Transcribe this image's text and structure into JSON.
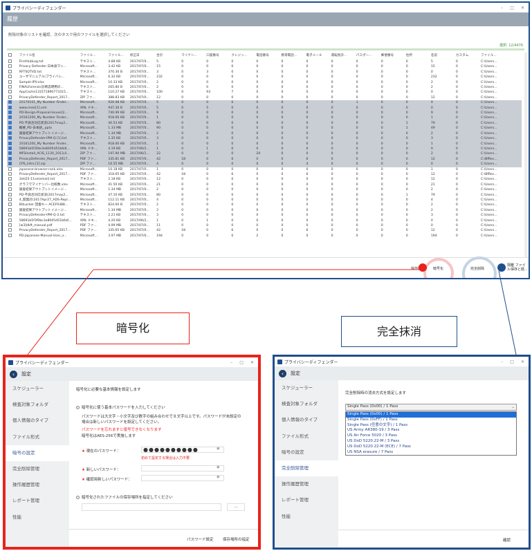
{
  "main": {
    "window_title": "プライバシーディフェンダー",
    "header": "履歴",
    "description": "削除対象のリストを確認、次のタスク用のファイルを選択してください",
    "selected_count": "選択: 12/4476",
    "columns": [
      "ファイル名",
      "ファイル...",
      "ファイル...",
      "修正日",
      "合計",
      "マイナン...",
      "口座番号",
      "クレジッ...",
      "電話番号",
      "携帯電話...",
      "電子メール",
      "運転免許...",
      "パスポー...",
      "郵便番号",
      "住所",
      "名前",
      "カスタム",
      "ファイル..."
    ],
    "rows": [
      {
        "on": false,
        "c": [
          "FirstHubLog.txt",
          "テキスト...",
          "4.88 KB",
          "2017/07/0...",
          "5",
          "0",
          "0",
          "0",
          "0",
          "0",
          "0",
          "0",
          "0",
          "0",
          "0",
          "5",
          "0",
          "C:\\Users..."
        ]
      },
      {
        "on": false,
        "c": [
          "Privacy Defender 日本語マニ...",
          "Microsoft...",
          "3.42 KB",
          "2017/07/0...",
          "15",
          "0",
          "0",
          "0",
          "0",
          "0",
          "0",
          "0",
          "0",
          "0",
          "0",
          "15",
          "0",
          "C:\\Users..."
        ]
      },
      {
        "on": false,
        "c": [
          "RFTSQTVD.txt",
          "テキスト...",
          "370.30 B",
          "2017/07/0...",
          "3",
          "0",
          "3",
          "0",
          "0",
          "0",
          "0",
          "0",
          "0",
          "0",
          "0",
          "0",
          "0",
          "C:\\Users..."
        ]
      },
      {
        "on": false,
        "c": [
          "ユーザマニュアル(プライバシ...",
          "Microsoft...",
          "6.32 KB",
          "2017/07/0...",
          "232",
          "0",
          "0",
          "0",
          "0",
          "0",
          "0",
          "0",
          "0",
          "0",
          "0",
          "232",
          "0",
          "C:\\Users..."
        ]
      },
      {
        "on": false,
        "c": [
          "Sample-IPV.xlsx",
          "Microsoft...",
          "10.33 KB",
          "2017/07/0...",
          "2",
          "0",
          "0",
          "0",
          "0",
          "0",
          "0",
          "0",
          "0",
          "0",
          "0",
          "2",
          "0",
          "C:\\Users..."
        ]
      },
      {
        "on": false,
        "c": [
          "FINALForensic診断説明用の...",
          "テキスト...",
          "265.80 B",
          "2017/07/0...",
          "2",
          "0",
          "0",
          "0",
          "0",
          "0",
          "0",
          "0",
          "0",
          "0",
          "0",
          "2",
          "0",
          "C:\\Users..."
        ]
      },
      {
        "on": false,
        "c": [
          "AppCache131571890773315...",
          "テキスト...",
          "110.27 KB",
          "2017/07/0...",
          "100",
          "0",
          "93",
          "7",
          "0",
          "0",
          "0",
          "0",
          "0",
          "0",
          "0",
          "0",
          "0",
          "C:\\Users..."
        ]
      },
      {
        "on": false,
        "c": [
          "PrivacyDefender_Report_2017...",
          "ZIP ファ...",
          "388.83 KB",
          "2017/07/0...",
          "12",
          "0",
          "0",
          "0",
          "0",
          "0",
          "0",
          "0",
          "0",
          "0",
          "0",
          "12",
          "0",
          "C:\\Users..."
        ]
      },
      {
        "on": true,
        "c": [
          "20170101_My Number Finder...",
          "Microsoft...",
          "926.08 KB",
          "2017/07/0...",
          "5",
          "0",
          "0",
          "0",
          "0",
          "0",
          "0",
          "0",
          "1",
          "0",
          "0",
          "0",
          "0",
          "C:\\Users..."
        ]
      },
      {
        "on": true,
        "c": [
          "www.msie[1].xml",
          "XML ドキ...",
          "947.30 B",
          "2017/07/0...",
          "5",
          "0",
          "5",
          "0",
          "0",
          "0",
          "0",
          "0",
          "0",
          "0",
          "0",
          "0",
          "0",
          "C:\\Users..."
        ]
      },
      {
        "on": true,
        "c": [
          "PD-Design-Proposal-Issues[2...",
          "Microsoft...",
          "740.99 KB",
          "2017/07/0...",
          "9",
          "0",
          "0",
          "0",
          "0",
          "0",
          "0",
          "0",
          "0",
          "0",
          "0",
          "9",
          "0",
          "C:\\Users..."
        ]
      },
      {
        "on": true,
        "c": [
          "20161200_My Number Finder...",
          "Microsoft...",
          "918.00 KB",
          "2017/07/0...",
          "1",
          "0",
          "0",
          "0",
          "0",
          "0",
          "0",
          "0",
          "0",
          "0",
          "0",
          "1",
          "0",
          "C:\\Users..."
        ]
      },
      {
        "on": true,
        "c": [
          "PD-不具合対応状況(2017may2...",
          "Microsoft...",
          "40.53 KB",
          "2017/07/0...",
          "80",
          "0",
          "0",
          "0",
          "0",
          "0",
          "0",
          "0",
          "0",
          "0",
          "1",
          "79",
          "0",
          "C:\\Users..."
        ]
      },
      {
        "on": true,
        "c": [
          "概要_PD-日本語_.pptx",
          "Microsoft...",
          "1.33 MB",
          "2017/07/0...",
          "90",
          "0",
          "0",
          "0",
          "0",
          "0",
          "0",
          "0",
          "0",
          "0",
          "1",
          "49",
          "0",
          "C:\\Users..."
        ]
      },
      {
        "on": true,
        "c": [
          "調査結果アウトプットイメージ...",
          "Microsoft...",
          "1.34 MB",
          "2017/07/0...",
          "2",
          "0",
          "0",
          "0",
          "0",
          "0",
          "0",
          "0",
          "0",
          "0",
          "0",
          "2",
          "0",
          "C:\\Users..."
        ]
      },
      {
        "on": true,
        "c": [
          "PrivacyDefender-IPM-Q [1].txt",
          "テキスト...",
          "2.35 KB",
          "2017/07/0...",
          "3",
          "0",
          "0",
          "0",
          "0",
          "0",
          "0",
          "0",
          "0",
          "0",
          "0",
          "3",
          "0",
          "C:\\Users..."
        ]
      },
      {
        "on": true,
        "c": [
          "20161200_My Number Finder...",
          "Microsoft...",
          "918.00 KB",
          "2017/07/0...",
          "1",
          "0",
          "0",
          "0",
          "0",
          "0",
          "0",
          "0",
          "0",
          "0",
          "0",
          "1",
          "0",
          "C:\\Users..."
        ]
      },
      {
        "on": true,
        "c": [
          "58691b5f3fde3e8005d51b6d[...",
          "XML ドキ...",
          "4.19 KB",
          "2017/06/2...",
          "1",
          "0",
          "1",
          "0",
          "0",
          "0",
          "0",
          "0",
          "0",
          "0",
          "0",
          "0",
          "0",
          "C:\\Users..."
        ]
      },
      {
        "on": true,
        "c": [
          "MFSInstall_ACIS_1130_2013,0...",
          "ZIP ファ...",
          "197.90 MB",
          "2017/06/1...",
          "22",
          "0",
          "0",
          "0",
          "20",
          "0",
          "0",
          "0",
          "0",
          "0",
          "0",
          "2",
          "0",
          "C:\\Users..."
        ]
      },
      {
        "on": true,
        "c": [
          "PrivacyDefender_Report_2017...",
          "PDF ファ...",
          "335.81 KB",
          "2017/07/0...",
          "42",
          "18",
          "0",
          "6",
          "0",
          "0",
          "6",
          "0",
          "0",
          "0",
          "0",
          "12",
          "0",
          "C:\\BfRec..."
        ]
      },
      {
        "on": true,
        "c": [
          "CPS_Intro [1].zip",
          "ZIP ファ...",
          "16.55 MB",
          "2017/07/0...",
          "4",
          "0",
          "0",
          "0",
          "0",
          "0",
          "4",
          "0",
          "0",
          "0",
          "0",
          "0",
          "0",
          "C:\\Users..."
        ]
      },
      {
        "on": false,
        "c": [
          "japanese-browser-rank.xlsx",
          "Microsoft...",
          "10.18 KB",
          "2017/07/0...",
          "1",
          "0",
          "0",
          "0",
          "0",
          "0",
          "0",
          "0",
          "0",
          "0",
          "0",
          "1",
          "0",
          "C:\\Users..."
        ]
      },
      {
        "on": false,
        "c": [
          "PrivacyDefender_Report_2017...",
          "PDF ファ...",
          "318.65 KB",
          "2017/07/0...",
          "42",
          "18",
          "0",
          "6",
          "0",
          "0",
          "6",
          "0",
          "0",
          "0",
          "0",
          "12",
          "0",
          "C:\\BfRec..."
        ]
      },
      {
        "on": false,
        "c": [
          "3eti25-11ce(email).txt",
          "テキスト...",
          "2.18 KB",
          "2017/07/0...",
          "12",
          "0",
          "0",
          "0",
          "0",
          "0",
          "0",
          "0",
          "0",
          "0",
          "0",
          "12",
          "0",
          "C:\\Users..."
        ]
      },
      {
        "on": false,
        "c": [
          "グラフでマイナンバー比較数.xlsx",
          "Microsoft...",
          "41.50 KB",
          "2017/07/0...",
          "21",
          "0",
          "0",
          "0",
          "0",
          "0",
          "0",
          "0",
          "0",
          "0",
          "0",
          "21",
          "0",
          "C:\\Users..."
        ]
      },
      {
        "on": false,
        "c": [
          "調査結果アウトプットイメージ...",
          "Microsoft...",
          "1.34 MB",
          "2017/07/0...",
          "2",
          "0",
          "0",
          "0",
          "0",
          "0",
          "0",
          "0",
          "0",
          "0",
          "0",
          "2",
          "0",
          "C:\\Users..."
        ]
      },
      {
        "on": false,
        "c": [
          "PD-不具合対応状況(2017may2...",
          "Microsoft...",
          "47.10 KB",
          "2017/07/0...",
          "80",
          "0",
          "0",
          "0",
          "0",
          "0",
          "0",
          "0",
          "0",
          "0",
          "1",
          "79",
          "0",
          "C:\\Users..."
        ]
      },
      {
        "on": false,
        "c": [
          "4_開発計(2017Apr27_ADS-Repl...",
          "Microsoft...",
          "112.11 KB",
          "2017/07/0...",
          "4",
          "0",
          "0",
          "0",
          "0",
          "0",
          "0",
          "0",
          "0",
          "0",
          "0",
          "4",
          "0",
          "C:\\Users..."
        ]
      },
      {
        "on": false,
        "c": [
          "BitLocker 回復キー ACEF9388...",
          "テキスト...",
          "824.00 B",
          "2017/07/0...",
          "2",
          "0",
          "0",
          "0",
          "0",
          "0",
          "0",
          "0",
          "0",
          "0",
          "0",
          "2",
          "0",
          "C:\\Users..."
        ]
      },
      {
        "on": false,
        "c": [
          "調査結果アウトプットイメージ...",
          "Microsoft...",
          "1.34 MB",
          "2017/07/0...",
          "2",
          "0",
          "0",
          "0",
          "0",
          "0",
          "0",
          "0",
          "0",
          "0",
          "0",
          "2",
          "0",
          "C:\\Users..."
        ]
      },
      {
        "on": false,
        "c": [
          "PrivacyDefender-IPM-Q-2.txt",
          "テキスト...",
          "2.21 KB",
          "2017/07/0...",
          "3",
          "0",
          "0",
          "0",
          "0",
          "0",
          "0",
          "0",
          "0",
          "0",
          "0",
          "3",
          "0",
          "C:\\Users..."
        ]
      },
      {
        "on": false,
        "c": [
          "58691b5f3f0bc3e8005d51b6d[...",
          "XML ドキ...",
          "4.20 KB",
          "2017/06/2...",
          "1",
          "0",
          "1",
          "0",
          "0",
          "0",
          "0",
          "0",
          "0",
          "0",
          "0",
          "0",
          "0",
          "C:\\Users..."
        ]
      },
      {
        "on": false,
        "c": [
          "[w3]dkft_manual.pdf",
          "PDF ファ...",
          "4.99 MB",
          "2017/07/0...",
          "11",
          "0",
          "0",
          "0",
          "0",
          "0",
          "0",
          "0",
          "0",
          "0",
          "0",
          "0",
          "0",
          "C:\\Users..."
        ]
      },
      {
        "on": false,
        "c": [
          "PrivacyDefender_Report_2017...",
          "PDF ファ...",
          "335.65 KB",
          "2017/07/0...",
          "42",
          "18",
          "0",
          "6",
          "0",
          "0",
          "6",
          "0",
          "0",
          "0",
          "0",
          "12",
          "0",
          "C:\\Users..."
        ]
      },
      {
        "on": false,
        "c": [
          "PD-Japanese-Manual-User_v...",
          "Microsoft...",
          "3.97 MB",
          "2017/07/0...",
          "194",
          "0",
          "0",
          "0",
          "2",
          "0",
          "0",
          "0",
          "0",
          "0",
          "0",
          "194",
          "0",
          "C:\\Users..."
        ]
      }
    ],
    "foot_btn_1": "操作履歴",
    "foot_btn_2": "暗号化",
    "foot_btn_3": "完全削除",
    "foot_btn_4": "隔離 ファイル保存と経...",
    "pink": "#f5a0a8",
    "blue": "#1f4e8c",
    "red": "#e8231b"
  },
  "labels": {
    "encrypt": "暗号化",
    "wipe": "完全抹消"
  },
  "settings": {
    "window_title": "プライバシーディフェンダー",
    "header": "設定",
    "menu": [
      "スケジューラー",
      "検査対象フォルダ",
      "個人情報のタイプ",
      "ファイル形式",
      "暗号の設定",
      "完全削除管理",
      "操作履歴管理",
      "レポート管理",
      "性能"
    ]
  },
  "enc": {
    "intro": "暗号化に必要な基本情報を設定します",
    "opt1": "暗号化に使う基本パスワードを入力してください",
    "note": "パスワードは大文字・小文字及び数字の組み合わせで８文字以上です。パスワードが未設定の場合は新しいパスワードを設定してください。",
    "warn": "パスワードを忘れますと復号できなくなります",
    "algo": "暗号化はAES-256で実施します",
    "cur_label": "現在のパスワード：",
    "cur_value": "●●●●●●●●●●",
    "hint": "初めて設定する場合は入力不要",
    "new_label": "新しいパスワード：",
    "confirm_label": "確認用新しいパスワード：",
    "opt2": "暗号化されたファイルの保存場所を指定してください",
    "browse": "...",
    "btn1": "パスワード設定",
    "btn2": "保存場所の指定"
  },
  "wipe": {
    "intro": "完全削除時の消去方式を設定します",
    "selected": "Single Pass (0x00) / 1 Pass",
    "options": [
      "Single Pass (0x00) / 1 Pass",
      "Single Pass (0xFF) / 1 Pass",
      "Single Pass (任意の文字) / 1 Pass",
      "US Army AR380-19 / 3 Pass",
      "US Air Force 5020 / 3 Pass",
      "US DoD 5220.22-M / 3 Pass",
      "US DoD 5220.22-M (ECE) / 7 Pass",
      "US NSA erasure / 7 Pass"
    ],
    "ok": "確認"
  }
}
